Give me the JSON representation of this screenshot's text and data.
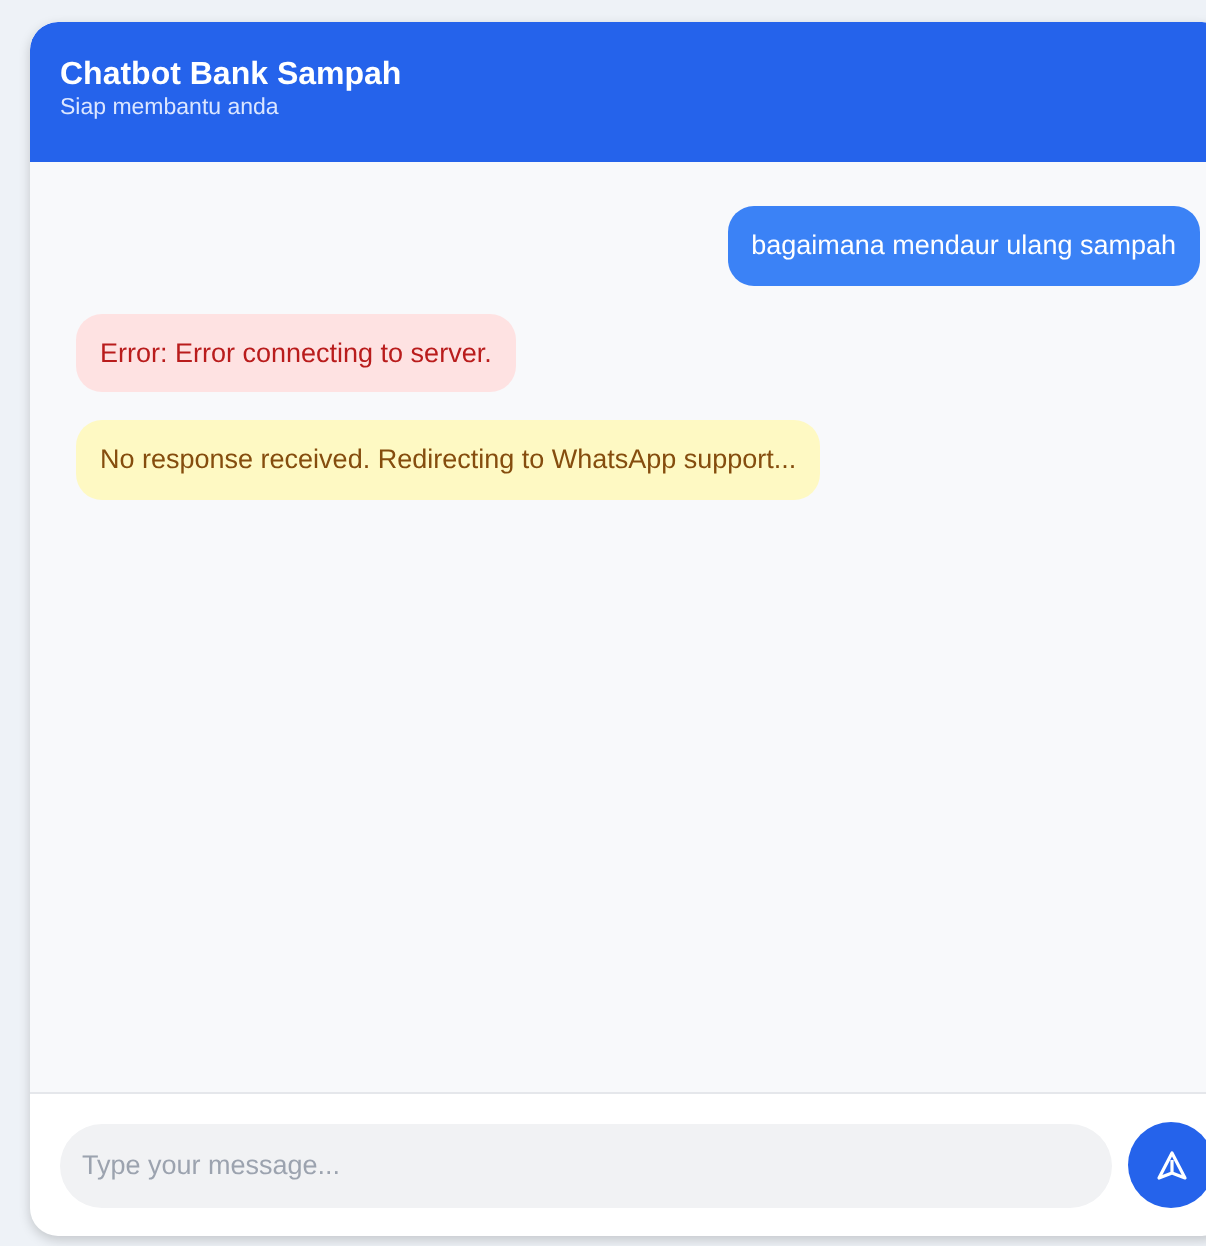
{
  "header": {
    "title": "Chatbot Bank Sampah",
    "subtitle": "Siap membantu anda"
  },
  "messages": [
    {
      "kind": "user",
      "text": "bagaimana mendaur ulang sampah"
    },
    {
      "kind": "error",
      "text": "Error: Error connecting to server."
    },
    {
      "kind": "warning",
      "text": "No response received. Redirecting to WhatsApp support..."
    }
  ],
  "composer": {
    "placeholder": "Type your message..."
  }
}
